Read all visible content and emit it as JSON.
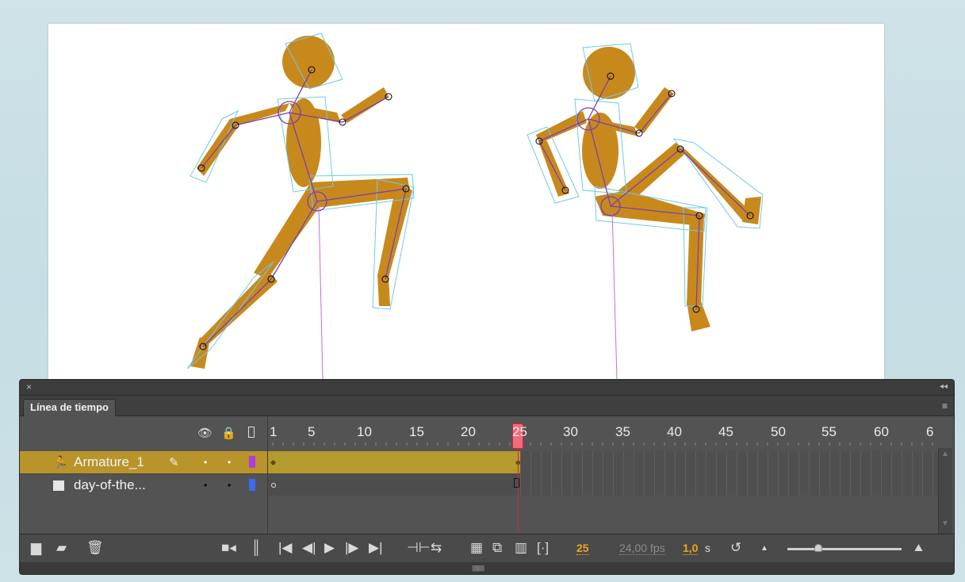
{
  "panel": {
    "tab_title": "Línea de tiempo",
    "close_glyph": "×",
    "collapse_glyph": "◂◂",
    "menu_glyph": "≡"
  },
  "ruler": {
    "labels": [
      "1",
      "5",
      "10",
      "15",
      "20",
      "25",
      "30",
      "35",
      "40",
      "45",
      "50",
      "55",
      "60",
      "6"
    ]
  },
  "layers": [
    {
      "name": "Armature_1",
      "icon": "armature-icon",
      "color": "#b13ce0",
      "selected": true
    },
    {
      "name": "day-of-the...",
      "icon": "layer-icon",
      "color": "#3b6cf0",
      "selected": false
    }
  ],
  "controls": {
    "current_frame": "25",
    "fps": "24,00 fps",
    "elapsed": "1,0",
    "elapsed_unit": "s"
  },
  "colors": {
    "selected_row": "#b8942a",
    "figure_fill": "#c8891c",
    "playhead": "#d0283a"
  }
}
